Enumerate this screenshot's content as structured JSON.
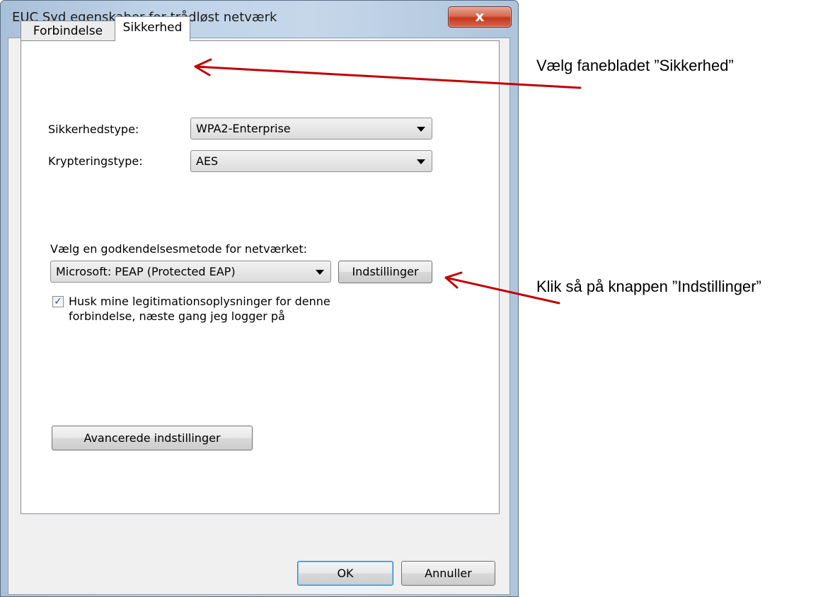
{
  "window": {
    "title": "EUC Syd egenskaber for trådløst netværk",
    "close_glyph": "x"
  },
  "tabs": [
    {
      "label": "Forbindelse",
      "active": false
    },
    {
      "label": "Sikkerhed",
      "active": true
    }
  ],
  "security": {
    "type_label": "Sikkerhedstype:",
    "type_value": "WPA2-Enterprise",
    "encryption_label": "Krypteringstype:",
    "encryption_value": "AES",
    "auth_method_label": "Vælg en godkendelsesmetode for netværket:",
    "auth_method_value": "Microsoft: PEAP (Protected EAP)",
    "settings_button": "Indstillinger",
    "remember_checkbox": {
      "checked": true,
      "line1": "Husk mine legitimationsoplysninger for denne",
      "line2": "forbindelse, næste gang jeg logger på"
    },
    "advanced_button": "Avancerede indstillinger"
  },
  "footer": {
    "ok_button": "OK",
    "cancel_button": "Annuller"
  },
  "annotations": {
    "tab_hint": "Vælg fanebladet ”Sikkerhed”",
    "button_hint": "Klik så på knappen ”Indstillinger”",
    "arrow_color": "#c00000"
  }
}
